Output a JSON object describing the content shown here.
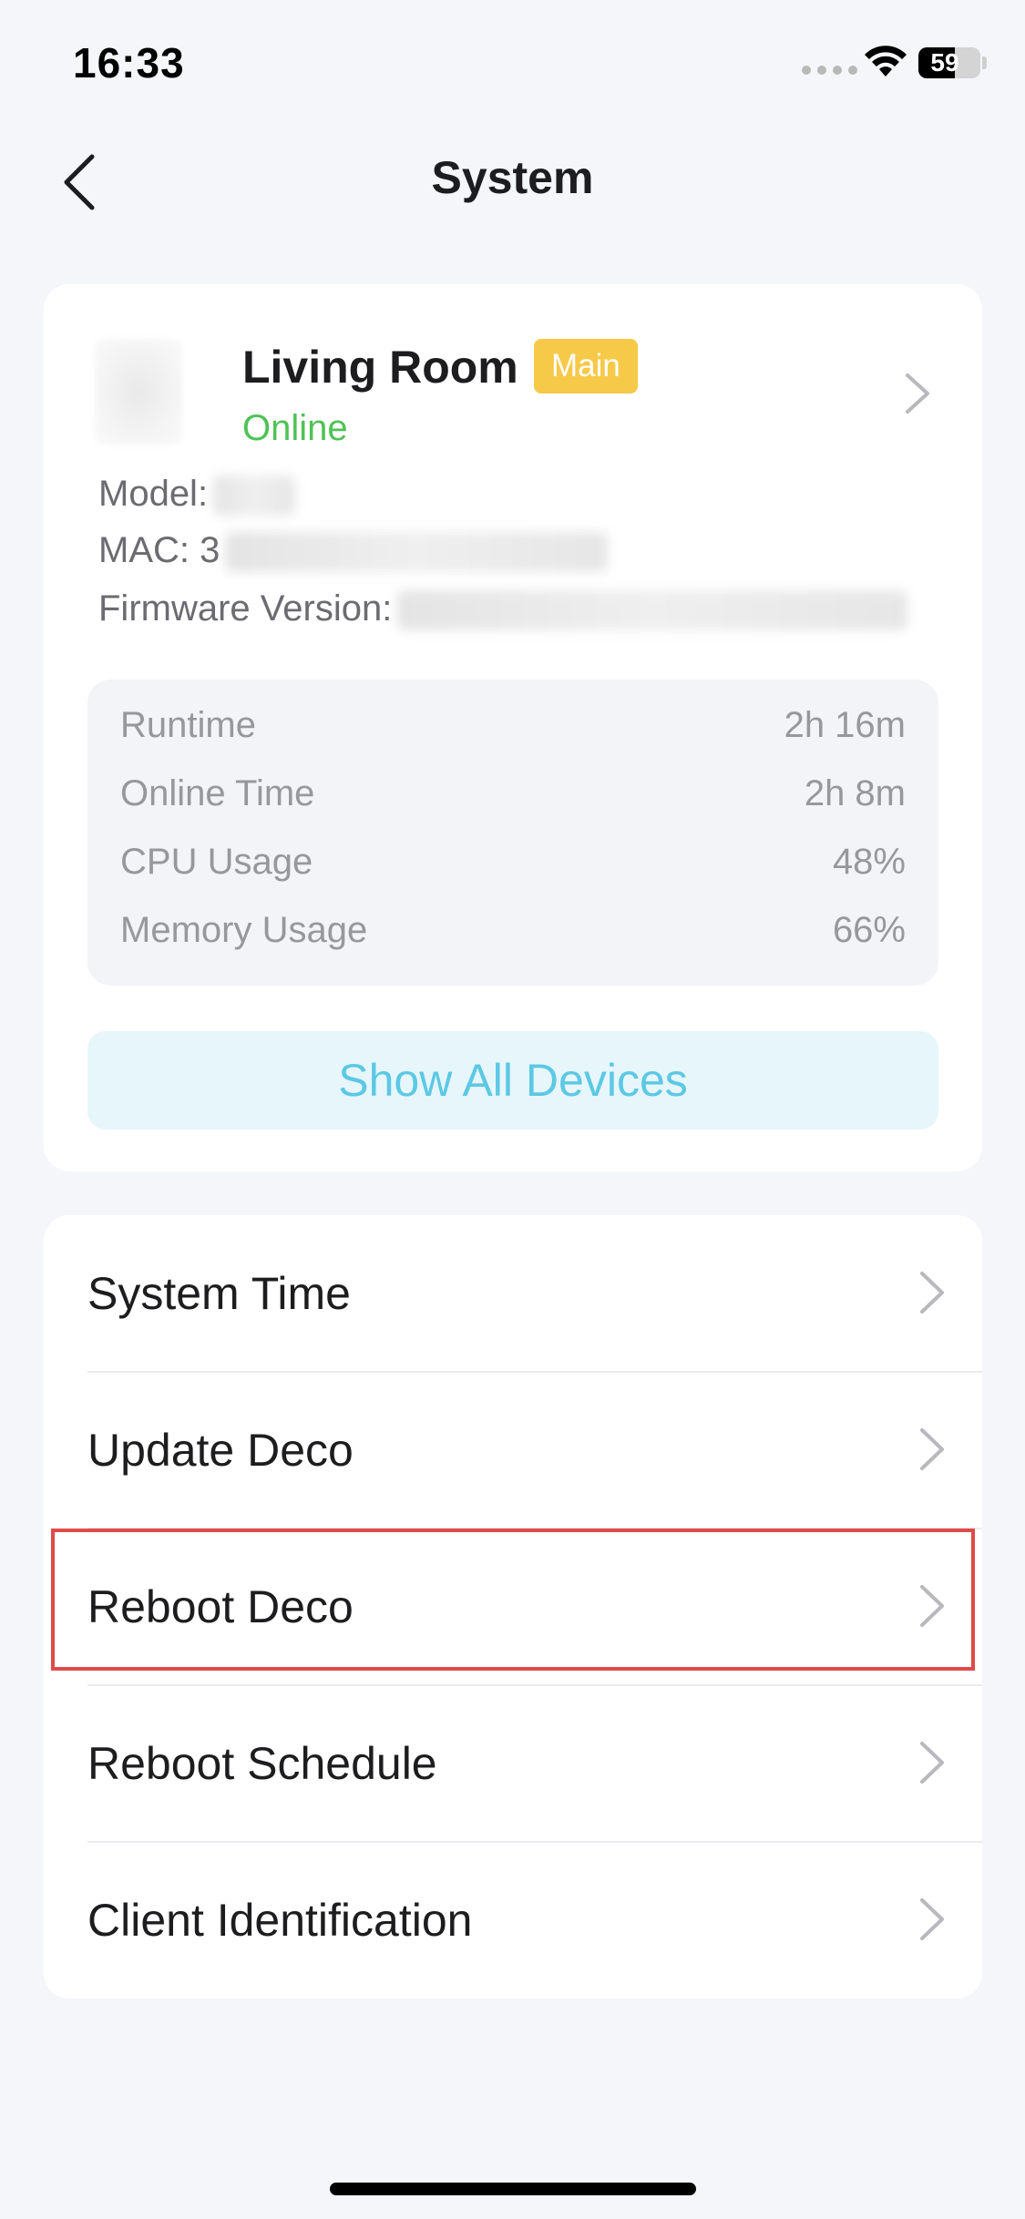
{
  "status_bar": {
    "time": "16:33",
    "battery_level": 59,
    "battery_text": "59",
    "icons": [
      "signal-dots-icon",
      "wifi-icon",
      "battery-icon"
    ]
  },
  "nav": {
    "title": "System",
    "back_icon": "chevron-left-icon"
  },
  "device": {
    "name": "Living Room",
    "badge": "Main",
    "status": "Online",
    "model_label": "Model:",
    "mac_label": "MAC: 3",
    "firmware_label": "Firmware Version:",
    "stats": [
      {
        "label": "Runtime",
        "value": "2h 16m"
      },
      {
        "label": "Online Time",
        "value": "2h 8m"
      },
      {
        "label": "CPU Usage",
        "value": "48%"
      },
      {
        "label": "Memory Usage",
        "value": "66%"
      }
    ],
    "show_all_label": "Show All Devices"
  },
  "menu": {
    "items": [
      {
        "label": "System Time"
      },
      {
        "label": "Update Deco"
      },
      {
        "label": "Reboot Deco",
        "highlighted": true
      },
      {
        "label": "Reboot Schedule"
      },
      {
        "label": "Client Identification"
      }
    ]
  },
  "colors": {
    "background": "#f4f6fa",
    "online": "#4fc255",
    "badge": "#f7c948",
    "accent": "#5cc8e4",
    "highlight_border": "#e04a4a"
  }
}
